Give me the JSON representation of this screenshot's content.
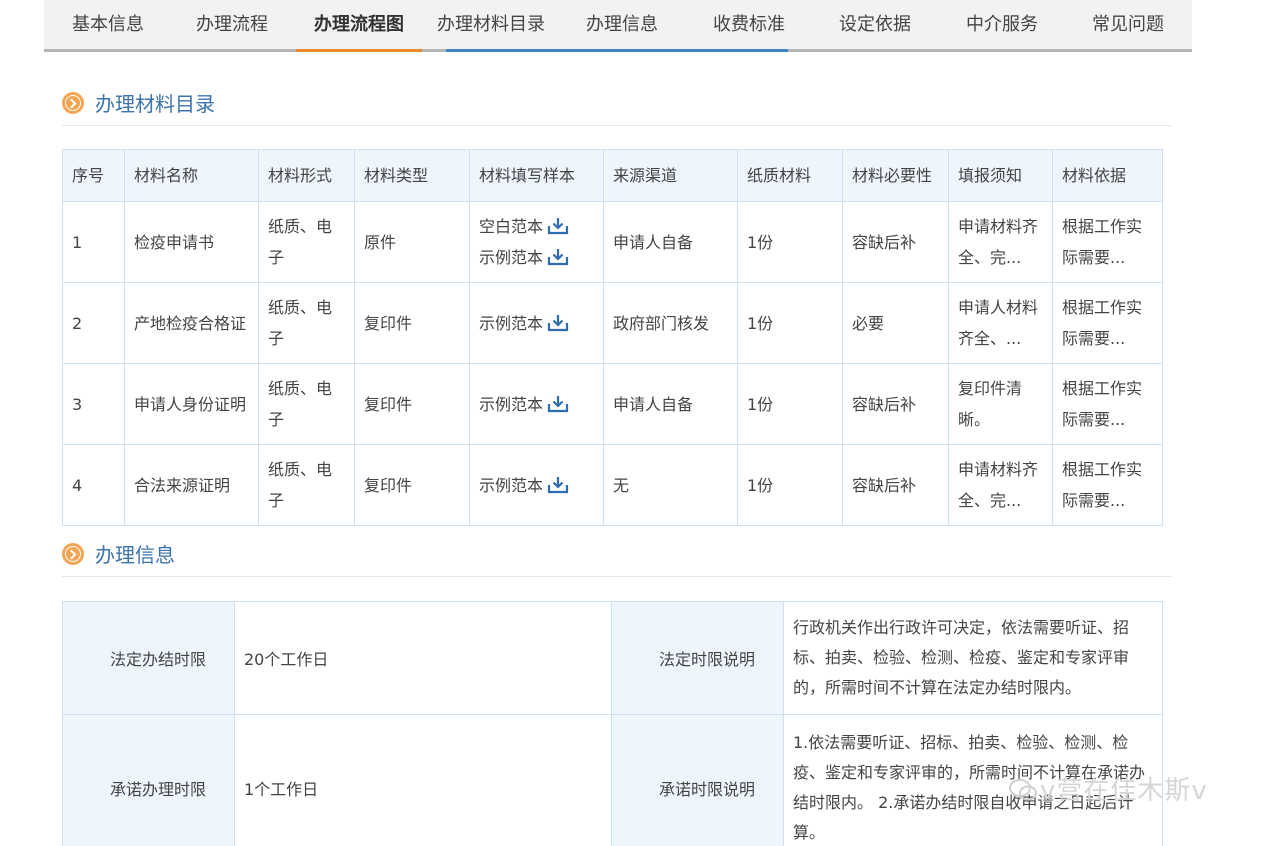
{
  "tabs": [
    {
      "label": "基本信息",
      "active": false
    },
    {
      "label": "办理流程",
      "active": false
    },
    {
      "label": "办理流程图",
      "active": true
    },
    {
      "label": "办理材料目录",
      "active": false
    },
    {
      "label": "办理信息",
      "active": false
    },
    {
      "label": "收费标准",
      "active": false
    },
    {
      "label": "设定依据",
      "active": false
    },
    {
      "label": "中介服务",
      "active": false
    },
    {
      "label": "常见问题",
      "active": false
    }
  ],
  "materials_section": {
    "title": "办理材料目录",
    "columns": [
      "序号",
      "材料名称",
      "材料形式",
      "材料类型",
      "材料填写样本",
      "来源渠道",
      "纸质材料",
      "材料必要性",
      "填报须知",
      "材料依据"
    ],
    "rows": [
      {
        "no": "1",
        "name": "检疫申请书",
        "form": "纸质、电子",
        "type": "原件",
        "samples": [
          "空白范本",
          "示例范本"
        ],
        "source": "申请人自备",
        "paper": "1份",
        "necessity": "容缺后补",
        "notice": "申请材料齐全、完...",
        "basis": "根据工作实际需要..."
      },
      {
        "no": "2",
        "name": "产地检疫合格证",
        "form": "纸质、电子",
        "type": "复印件",
        "samples": [
          "示例范本"
        ],
        "source": "政府部门核发",
        "paper": "1份",
        "necessity": "必要",
        "notice": "申请人材料齐全、...",
        "basis": "根据工作实际需要..."
      },
      {
        "no": "3",
        "name": "申请人身份证明",
        "form": "纸质、电子",
        "type": "复印件",
        "samples": [
          "示例范本"
        ],
        "source": "申请人自备",
        "paper": "1份",
        "necessity": "容缺后补",
        "notice": "复印件清晰。",
        "basis": "根据工作实际需要..."
      },
      {
        "no": "4",
        "name": "合法来源证明",
        "form": "纸质、电子",
        "type": "复印件",
        "samples": [
          "示例范本"
        ],
        "source": "无",
        "paper": "1份",
        "necessity": "容缺后补",
        "notice": "申请材料齐全、完...",
        "basis": "根据工作实际需要..."
      }
    ]
  },
  "info_section": {
    "title": "办理信息",
    "rows": [
      {
        "label": "法定办结时限",
        "value": "20个工作日",
        "desc_label": "法定时限说明",
        "desc": "行政机关作出行政许可决定，依法需要听证、招标、拍卖、检验、检测、检疫、鉴定和专家评审的，所需时间不计算在法定办结时限内。"
      },
      {
        "label": "承诺办理时限",
        "value": "1个工作日",
        "desc_label": "承诺时限说明",
        "desc": "1.依法需要听证、招标、拍卖、检验、检测、检疫、鉴定和专家评审的，所需时间不计算在承诺办结时限内。 2.承诺办结时限自收申请之日起后计算。"
      }
    ]
  },
  "watermark": {
    "text": "v营在佳木斯v"
  },
  "colors": {
    "accent_orange": "#ef8a2b",
    "tab_blue": "#3d86c4",
    "section_title": "#3c73ad",
    "header_bg": "#eef5fc",
    "border": "#cfe0ef",
    "download_icon": "#2f6db0"
  }
}
